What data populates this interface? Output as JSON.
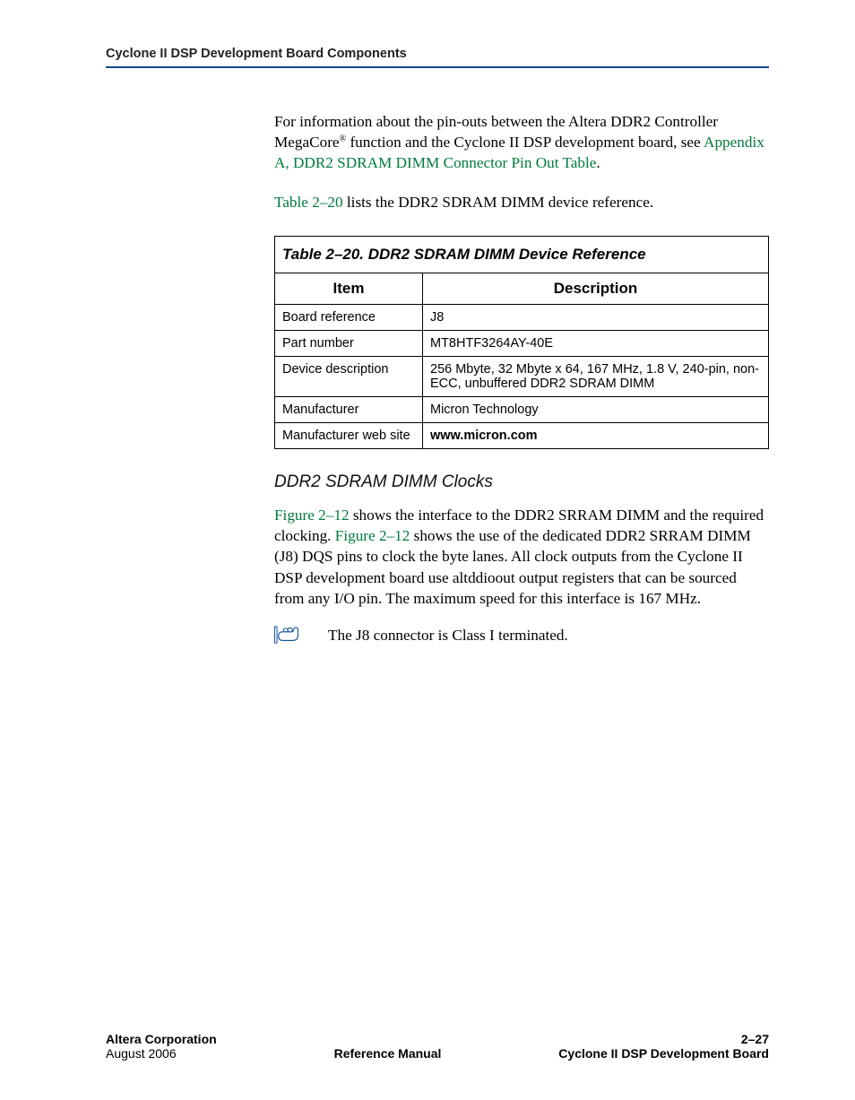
{
  "header": {
    "runhead": "Cyclone II DSP Development Board Components"
  },
  "paras": {
    "intro1a": "For information about the pin-outs between the Altera DDR2 Controller MegaCore",
    "intro1_sup": "®",
    "intro1b": " function and the Cyclone II DSP development board, see ",
    "intro1_link": "Appendix A, DDR2 SDRAM DIMM Connector Pin Out Table",
    "intro1c": ".",
    "intro2_link": "Table 2–20",
    "intro2_rest": " lists the DDR2 SDRAM DIMM device reference.",
    "clocks_a": "Figure 2–12",
    "clocks_b": " shows the interface to the DDR2 SRRAM DIMM and the required clocking. ",
    "clocks_c": "Figure 2–12",
    "clocks_d": " shows the use of the dedicated DDR2 SRRAM DIMM (J8) DQS pins to clock the byte lanes. All clock outputs from the Cyclone II DSP development board use altddioout output registers that can be sourced from any I/O pin. The maximum speed for this interface is 167 MHz.",
    "note": "The J8 connector is Class I terminated."
  },
  "subhead": "DDR2 SDRAM DIMM Clocks",
  "table": {
    "caption": "Table 2–20. DDR2 SDRAM DIMM Device Reference",
    "headers": {
      "item": "Item",
      "desc": "Description"
    },
    "rows": [
      {
        "item": "Board reference",
        "desc": "J8"
      },
      {
        "item": "Part number",
        "desc": "MT8HTF3264AY-40E"
      },
      {
        "item": "Device description",
        "desc": "256 Mbyte, 32 Mbyte x 64, 167 MHz, 1.8 V, 240-pin, non-ECC, unbuffered DDR2 SDRAM DIMM"
      },
      {
        "item": "Manufacturer",
        "desc": "Micron Technology"
      },
      {
        "item": "Manufacturer web site",
        "desc": "www.micron.com",
        "bold": true
      }
    ]
  },
  "footer": {
    "left1": "Altera Corporation",
    "left2": "August 2006",
    "center": "Reference Manual",
    "right1": "2–27",
    "right2": "Cyclone II DSP Development Board"
  }
}
